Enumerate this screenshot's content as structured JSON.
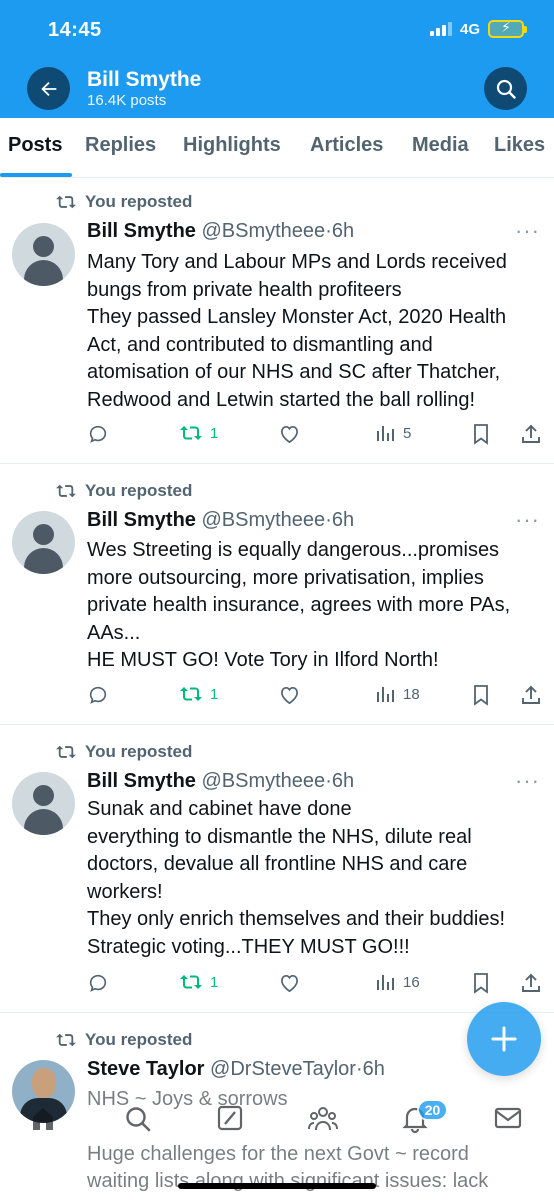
{
  "status_bar": {
    "time": "14:45",
    "network": "4G"
  },
  "header": {
    "name": "Bill Smythe",
    "post_count": "16.4K posts"
  },
  "tabs": [
    {
      "label": "Posts",
      "active": true
    },
    {
      "label": "Replies"
    },
    {
      "label": "Highlights"
    },
    {
      "label": "Articles"
    },
    {
      "label": "Media"
    },
    {
      "label": "Likes"
    }
  ],
  "posts": [
    {
      "repost_label": "You reposted",
      "name": "Bill Smythe",
      "handle": "@BSmytheee",
      "time": "6h",
      "more": "···",
      "lines": [
        "Many Tory and Labour MPs and Lords received",
        "bungs from private health profiteers",
        "They passed Lansley Monster Act, 2020 Health",
        "Act, and contributed to dismantling and",
        "atomisation of our NHS and SC after Thatcher,",
        "Redwood and Letwin started the ball rolling!"
      ],
      "reposts": "1",
      "views": "5"
    },
    {
      "repost_label": "You reposted",
      "name": "Bill Smythe",
      "handle": "@BSmytheee",
      "time": "6h",
      "more": "···",
      "lines": [
        "Wes Streeting is equally dangerous...promises",
        "more outsourcing, more privatisation, implies",
        "private health insurance, agrees with more PAs,",
        "AAs...",
        "HE MUST GO! Vote Tory in Ilford North!"
      ],
      "reposts": "1",
      "views": "18"
    },
    {
      "repost_label": "You reposted",
      "name": "Bill Smythe",
      "handle": "@BSmytheee",
      "time": "6h",
      "more": "···",
      "lines": [
        "Sunak and cabinet have done",
        "everything to dismantle the NHS, dilute real",
        "doctors, devalue all frontline NHS and care",
        "workers!",
        "They only enrich themselves and their buddies!",
        "Strategic voting...THEY MUST GO!!!"
      ],
      "reposts": "1",
      "views": "16"
    },
    {
      "repost_label": "You reposted",
      "name": "Steve Taylor",
      "handle": "@DrSteveTaylor",
      "time": "6h",
      "lines": [
        "NHS ~ Joys & sorrows",
        "",
        "Huge challenges for the next Govt ~ record",
        "waiting lists along with significant issues: lack"
      ]
    }
  ],
  "notifications_badge": "20",
  "colors": {
    "brand": "#1d9bf0",
    "repost_green": "#00ba7c",
    "muted": "#536471"
  }
}
